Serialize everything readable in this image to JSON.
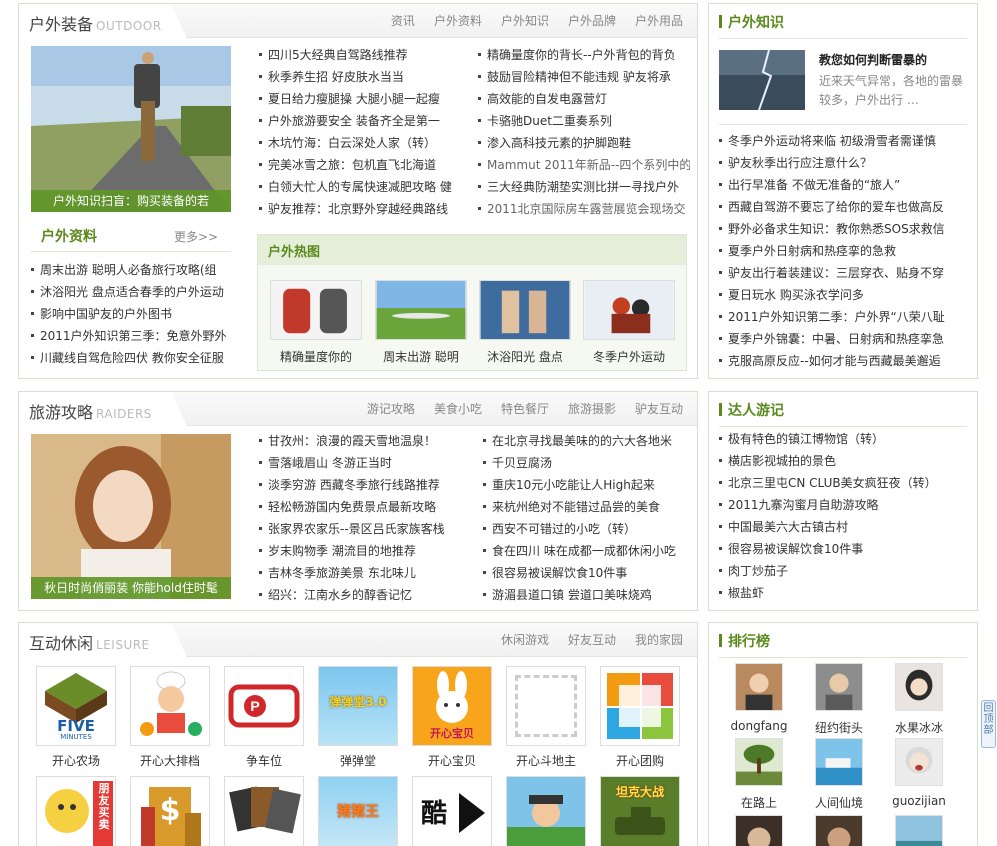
{
  "outdoor": {
    "title": "户外装备",
    "title_en": "OUTDOOR",
    "tabs": [
      "资讯",
      "户外资料",
      "户外知识",
      "户外品牌",
      "户外用品"
    ],
    "photo_caption": "户外知识扫盲：购买装备的若",
    "col1": [
      "四川5大经典自驾路线推荐",
      "秋季养生招 好皮肤水当当",
      "夏日给力瘦腿操 大腿小腿一起瘦",
      "户外旅游要安全 装备齐全是第一",
      "木坑竹海：白云深处人家（转）",
      "完美冰雪之旅：包机直飞北海道",
      "白领大忙人的专属快速减肥攻略 健",
      "驴友推荐：北京野外穿越经典路线"
    ],
    "col2": [
      "精确量度你的背长--户外背包的背负",
      "鼓励冒险精神但不能违规 驴友将承",
      "高效能的自发电露营灯",
      "卡骆驰Duet二重奏系列",
      "渗入高科技元素的护脚跑鞋",
      "Mammut 2011年新品--四个系列中的",
      "三大经典防潮垫实测比拼一寻找户外",
      "2011北京国际房车露营展览会现场交"
    ],
    "data_title": "户外资料",
    "data_more": "更多>>",
    "data_list": [
      "周末出游 聪明人必备旅行攻略(组",
      "沐浴阳光 盘点适合春季的户外运动",
      "影响中国驴友的户外图书",
      "2011户外知识第三季：免意外野外",
      "川藏线自驾危险四伏 教你安全征服"
    ],
    "hot_title": "户外热图",
    "hot": [
      "精确量度你的",
      "周末出游 聪明",
      "沐浴阳光 盘点",
      "冬季户外运动"
    ]
  },
  "knowledge": {
    "title": "户外知识",
    "feature_title": "教您如何判断雷暴的",
    "feature_desc": "近来天气异常，各地的雷暴较多，户外出行 …",
    "list": [
      "冬季户外运动将来临 初级滑雪者需谨慎",
      "驴友秋季出行应注意什么？",
      "出行早准备 不做无准备的“旅人”",
      "西藏自驾游不要忘了给你的爱车也做高反",
      "野外必备求生知识：教你熟悉SOS求救信",
      "夏季户外日射病和热痉挛的急救",
      "驴友出行着装建议：三层穿衣、贴身不穿",
      "夏日玩水 购买泳衣学问多",
      "2011户外知识第二季：户外界“八荣八耻",
      "夏季户外锦囊：中暑、日射病和热痉挛急",
      "克服高原反应--如何才能与西藏最美邂逅"
    ]
  },
  "travel": {
    "title": "旅游攻略",
    "title_en": "RAIDERS",
    "tabs": [
      "游记攻略",
      "美食小吃",
      "特色餐厅",
      "旅游摄影",
      "驴友互动"
    ],
    "photo_caption": "秋日时尚俏丽装 你能hold住时髦",
    "col1": [
      "甘孜州：浪漫的霞天雪地温泉！",
      "雪落峨眉山 冬游正当时",
      "淡季穷游 西藏冬季旅行线路推荐",
      "轻松畅游国内免费景点最新攻略",
      "张家界农家乐--景区吕氏家族客栈",
      "岁末购物季 潮流目的地推荐",
      "吉林冬季旅游美景 东北味儿",
      "绍兴：江南水乡的醇香记忆"
    ],
    "col2": [
      "在北京寻找最美味的的六大各地米",
      "千贝豆腐汤",
      "重庆10元小吃能让人High起来",
      "来杭州绝对不能错过品尝的美食",
      "西安不可错过的小吃（转）",
      "食在四川 味在成都一成都休闲小吃",
      "很容易被误解饮食10件事",
      "游湄县道口镇 尝道口美味烧鸡"
    ]
  },
  "experts": {
    "title": "达人游记",
    "list": [
      "极有特色的镇江博物馆（转）",
      "横店影视城拍的景色",
      "北京三里屯CN CLUB美女疯狂夜（转）",
      "2011九寨沟蜜月自助游攻略",
      "中国最美六大古镇古村",
      "很容易被误解饮食10件事",
      "肉丁炒茄子",
      "椒盐虾"
    ]
  },
  "leisure": {
    "title": "互动休闲",
    "title_en": "LEISURE",
    "tabs": [
      "休闲游戏",
      "好友互动",
      "我的家园"
    ],
    "games": [
      "开心农场",
      "开心大排档",
      "争车位",
      "弹弹堂",
      "开心宝贝",
      "开心斗地主",
      "开心团购"
    ],
    "five_text": "FIVE",
    "five_sub": "MINUTES",
    "baby_text": "开心宝贝",
    "dandan_text": "弹弹堂3.0",
    "row2_texts": [
      "朋友买卖",
      "$",
      "",
      "猪猪王",
      "酷",
      "",
      "坦克大战"
    ]
  },
  "ranking": {
    "title": "排行榜",
    "users": [
      "dongfang",
      "纽约街头",
      "水果冰冰",
      "在路上",
      "人间仙境",
      "guozijian"
    ]
  },
  "back_top": "回顶部",
  "colors": {
    "accent": "#5a8a1e",
    "caption_bg": "#609628",
    "border": "#d9dfcc"
  }
}
